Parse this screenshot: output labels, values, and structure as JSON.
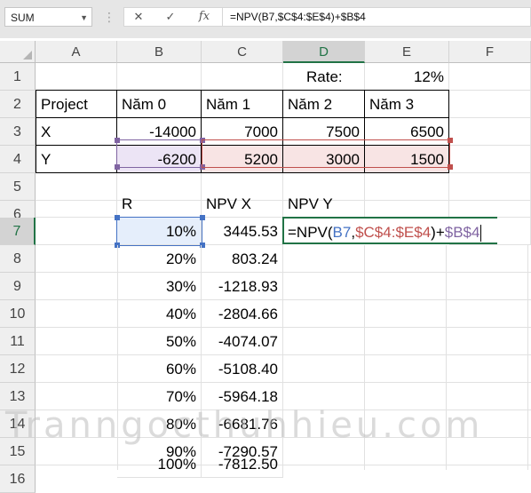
{
  "formula_bar": {
    "name_box": "SUM",
    "cancel_symbol": "✕",
    "enter_symbol": "✓",
    "fx_label": "fx",
    "formula": "=NPV(B7,$C$4:$E$4)+$B$4"
  },
  "columns": [
    "A",
    "B",
    "C",
    "D",
    "E",
    "F"
  ],
  "rows": [
    "1",
    "2",
    "3",
    "4",
    "5",
    "6",
    "7",
    "8",
    "9",
    "10",
    "11",
    "12",
    "13",
    "14",
    "15",
    "16"
  ],
  "cells": {
    "D1": "Rate:",
    "E1": "12%",
    "A2": "Project",
    "B2": "Năm 0",
    "C2": "Năm 1",
    "D2": "Năm 2",
    "E2": "Năm 3",
    "A3": "X",
    "B3": "-14000",
    "C3": "7000",
    "D3": "7500",
    "E3": "6500",
    "A4": "Y",
    "B4": "-6200",
    "C4": "5200",
    "D4": "3000",
    "E4": "1500",
    "B6": "R",
    "C6": "NPV X",
    "D6": "NPV Y",
    "B7": "10%",
    "C7": "3445.53",
    "B8": "20%",
    "C8": "803.24",
    "B9": "30%",
    "C9": "-1218.93",
    "B10": "40%",
    "C10": "-2804.66",
    "B11": "50%",
    "C11": "-4074.07",
    "B12": "60%",
    "C12": "-5108.40",
    "B13": "70%",
    "C13": "-5964.18",
    "B14": "80%",
    "C14": "-6681.76",
    "B15": "90%",
    "C15": "-7290.57",
    "B16": "100%",
    "C16": "-7812.50"
  },
  "edit_cell": {
    "parts": [
      "=NPV(",
      "B7",
      ",",
      "$C$4:$E$4",
      ")+",
      "$B$4"
    ]
  },
  "watermark": "Tranngocthuhhieu.com",
  "colors": {
    "excel_green": "#217346",
    "ref_blue": "#4472c4",
    "ref_red": "#c0504d",
    "ref_purple": "#8064a2"
  }
}
